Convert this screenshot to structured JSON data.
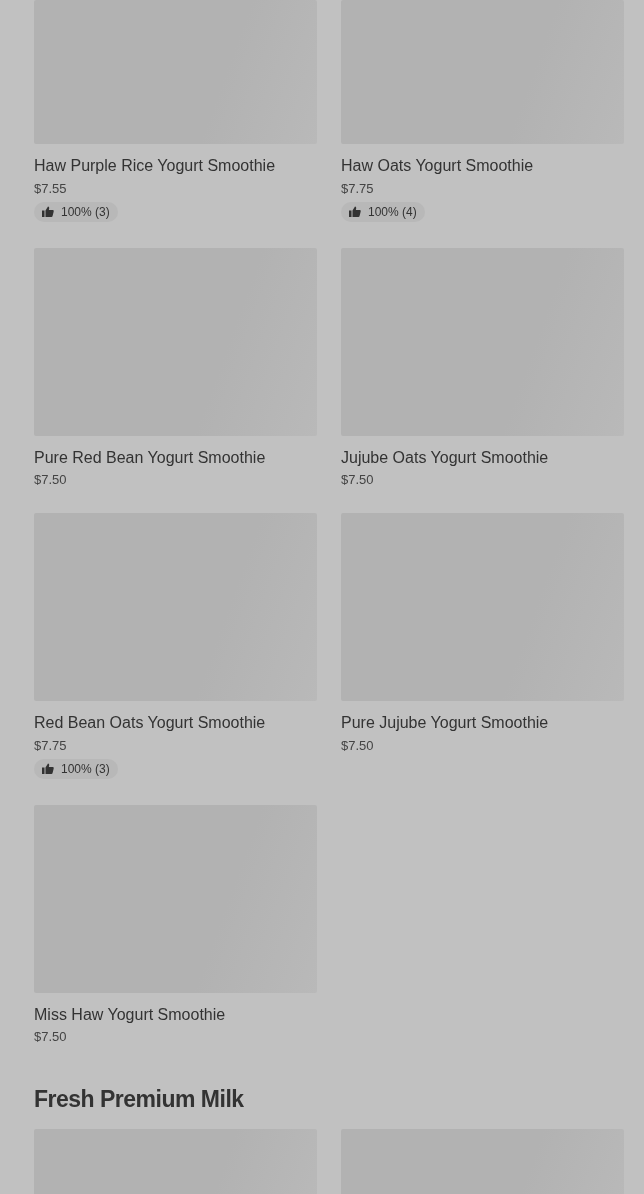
{
  "sections": [
    {
      "items": [
        {
          "kind": "item",
          "name": "Haw Purple Rice Yogurt Smoothie",
          "price": "$7.55",
          "rating": "100% (3)"
        },
        {
          "kind": "item",
          "name": "Haw Oats Yogurt Smoothie",
          "price": "$7.75",
          "rating": "100% (4)"
        },
        {
          "kind": "item",
          "name": "Pure Red Bean Yogurt Smoothie",
          "price": "$7.50"
        },
        {
          "kind": "item",
          "name": "Jujube Oats Yogurt Smoothie",
          "price": "$7.50"
        },
        {
          "kind": "item",
          "name": "Red Bean Oats Yogurt Smoothie",
          "price": "$7.75",
          "rating": "100% (3)"
        },
        {
          "kind": "item",
          "name": "Pure Jujube Yogurt Smoothie",
          "price": "$7.50"
        },
        {
          "kind": "item",
          "name": "Miss Haw Yogurt Smoothie",
          "price": "$7.50"
        }
      ]
    },
    {
      "title": "Fresh Premium Milk",
      "items": [
        {
          "kind": "image_only"
        },
        {
          "kind": "image_only"
        }
      ]
    }
  ]
}
